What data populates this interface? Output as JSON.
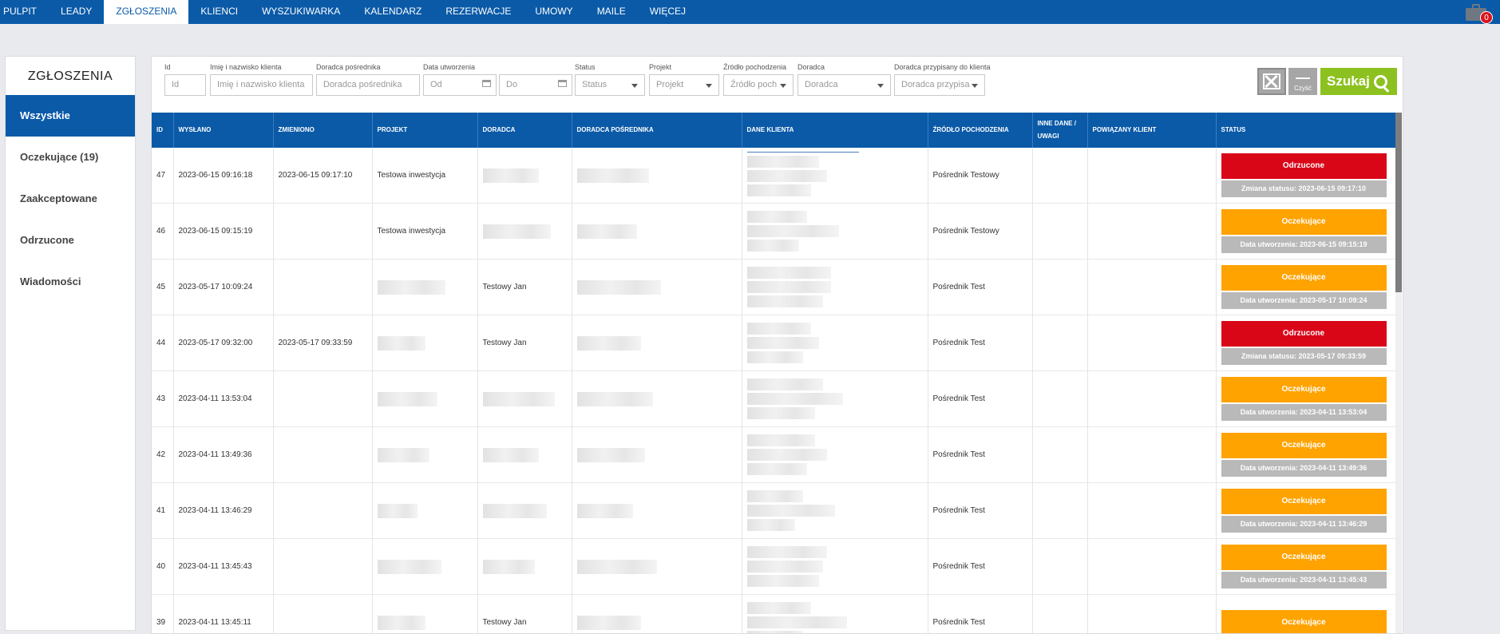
{
  "nav": {
    "items": [
      "PULPIT",
      "LEADY",
      "ZGŁOSZENIA",
      "KLIENCI",
      "WYSZUKIWARKA",
      "KALENDARZ",
      "REZERWACJE",
      "UMOWY",
      "MAILE",
      "WIĘCEJ"
    ],
    "active_index": 2,
    "briefcase_badge": "0"
  },
  "sidebar": {
    "title": "ZGŁOSZENIA",
    "items": [
      "Wszystkie",
      "Oczekujące (19)",
      "Zaakceptowane",
      "Odrzucone",
      "Wiadomości"
    ],
    "active_index": 0
  },
  "filters": {
    "id": {
      "label": "Id",
      "placeholder": "Id"
    },
    "client": {
      "label": "Imię i nazwisko klienta",
      "placeholder": "Imię i nazwisko klienta"
    },
    "broker_advisor": {
      "label": "Doradca pośrednika",
      "placeholder": "Doradca pośrednika"
    },
    "created": {
      "label": "Data utworzenia",
      "from": "Od",
      "to": "Do"
    },
    "status": {
      "label": "Status",
      "value": "Status"
    },
    "project": {
      "label": "Projekt",
      "value": "Projekt"
    },
    "source": {
      "label": "Źródło pochodzenia",
      "value": "Źródło poch"
    },
    "advisor": {
      "label": "Doradca",
      "value": "Doradca"
    },
    "assigned_advisor": {
      "label": "Doradca przypisany do klienta",
      "value": "Doradca przypisa"
    },
    "clear_label": "Czyść",
    "search_label": "Szukaj"
  },
  "table": {
    "headers": [
      "ID",
      "WYSŁANO",
      "ZMIENIONO",
      "PROJEKT",
      "DORADCA",
      "DORADCA POŚREDNIKA",
      "DANE KLIENTA",
      "ŹRÓDŁO POCHODZENIA",
      "INNE DANE / UWAGI",
      "POWIĄZANY KLIENT",
      "STATUS"
    ],
    "rows": [
      {
        "id": "47",
        "sent": "2023-06-15 09:16:18",
        "changed": "2023-06-15 09:17:10",
        "project": "Testowa inwestycja",
        "advisor": "",
        "source": "Pośrednik Testowy",
        "status": "Odrzucone",
        "status_color": "#d90618",
        "sub": "Zmiana statusu: 2023-06-15 09:17:10"
      },
      {
        "id": "46",
        "sent": "2023-06-15 09:15:19",
        "changed": "",
        "project": "Testowa inwestycja",
        "advisor": "",
        "source": "Pośrednik Testowy",
        "status": "Oczekujące",
        "status_color": "#ffa300",
        "sub": "Data utworzenia: 2023-06-15 09:15:19"
      },
      {
        "id": "45",
        "sent": "2023-05-17 10:09:24",
        "changed": "",
        "project": "",
        "advisor": "Testowy Jan",
        "source": "Pośrednik Test",
        "status": "Oczekujące",
        "status_color": "#ffa300",
        "sub": "Data utworzenia: 2023-05-17 10:09:24"
      },
      {
        "id": "44",
        "sent": "2023-05-17 09:32:00",
        "changed": "2023-05-17 09:33:59",
        "project": "",
        "advisor": "Testowy Jan",
        "source": "Pośrednik Test",
        "status": "Odrzucone",
        "status_color": "#d90618",
        "sub": "Zmiana statusu: 2023-05-17 09:33:59"
      },
      {
        "id": "43",
        "sent": "2023-04-11 13:53:04",
        "changed": "",
        "project": "",
        "advisor": "",
        "source": "Pośrednik Test",
        "status": "Oczekujące",
        "status_color": "#ffa300",
        "sub": "Data utworzenia: 2023-04-11 13:53:04"
      },
      {
        "id": "42",
        "sent": "2023-04-11 13:49:36",
        "changed": "",
        "project": "",
        "advisor": "",
        "source": "Pośrednik Test",
        "status": "Oczekujące",
        "status_color": "#ffa300",
        "sub": "Data utworzenia: 2023-04-11 13:49:36"
      },
      {
        "id": "41",
        "sent": "2023-04-11 13:46:29",
        "changed": "",
        "project": "",
        "advisor": "",
        "source": "Pośrednik Test",
        "status": "Oczekujące",
        "status_color": "#ffa300",
        "sub": "Data utworzenia: 2023-04-11 13:46:29"
      },
      {
        "id": "40",
        "sent": "2023-04-11 13:45:43",
        "changed": "",
        "project": "",
        "advisor": "",
        "source": "Pośrednik Test",
        "status": "Oczekujące",
        "status_color": "#ffa300",
        "sub": "Data utworzenia: 2023-04-11 13:45:43"
      },
      {
        "id": "39",
        "sent": "2023-04-11 13:45:11",
        "changed": "",
        "project": "",
        "advisor": "Testowy Jan",
        "source": "Pośrednik Test",
        "status": "Oczekujące",
        "status_color": "#ffa300",
        "sub": ""
      }
    ]
  }
}
